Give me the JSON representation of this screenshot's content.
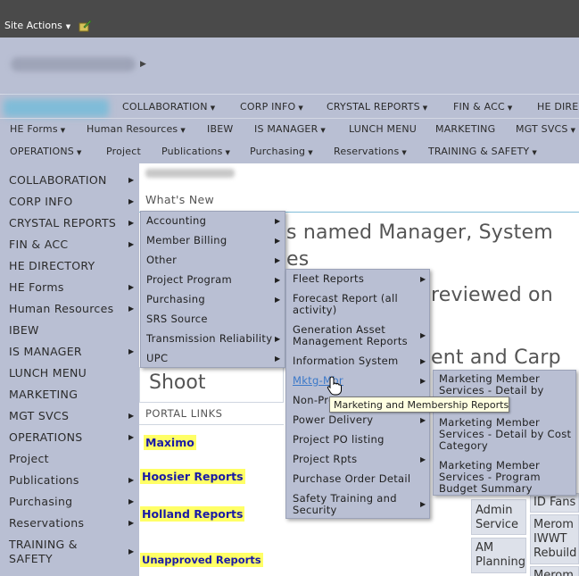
{
  "ribbon": {
    "site_actions_label": "Site Actions",
    "caret": "▼"
  },
  "top_nav": {
    "row1": [
      "COLLABORATION",
      "CORP INFO",
      "CRYSTAL REPORTS",
      "FIN & ACC",
      "HE DIRE"
    ],
    "row2": [
      "HE Forms",
      "Human Resources",
      "IBEW",
      "IS MANAGER",
      "LUNCH MENU",
      "MARKETING",
      "MGT SVCS"
    ],
    "row3": [
      "OPERATIONS",
      "Project",
      "Publications",
      "Purchasing",
      "Reservations",
      "TRAINING & SAFETY"
    ],
    "caret": "▼"
  },
  "sidebar": {
    "items": [
      "COLLABORATION",
      "CORP INFO",
      "CRYSTAL REPORTS",
      "FIN & ACC",
      "HE DIRECTORY",
      "HE Forms",
      "Human Resources",
      "IBEW",
      "IS MANAGER",
      "LUNCH MENU",
      "MARKETING",
      "MGT SVCS",
      "OPERATIONS",
      "Project",
      "Publications",
      "Purchasing",
      "Reservations",
      "TRAINING &",
      "SAFETY"
    ],
    "arrow": "▶"
  },
  "main": {
    "whats_new": "What's New",
    "big_line1": "s named Manager, System",
    "big_line2": "es",
    "big_line3": "reviewed on",
    "big_line4": "ent and Carp",
    "shoot": "Shoot",
    "portal_links": "PORTAL LINKS",
    "links": [
      "Maximo",
      "Hoosier Reports",
      "Holland Reports",
      "Unapproved Reports"
    ]
  },
  "tiles": [
    "Admin\nService",
    "AM\nPlanning",
    "ID Fans",
    "Merom\nIWWT\nRebuild",
    "Merom"
  ],
  "flyout1": {
    "items": [
      "Accounting",
      "Member Billing",
      "Other",
      "Project Program",
      "Purchasing",
      "SRS Source",
      "Transmission Reliability",
      "UPC"
    ]
  },
  "flyout2": {
    "items": [
      "Fleet Reports",
      "Forecast Report (all\nactivity)",
      "Generation Asset\nManagement Reports",
      "Information System",
      "Mktg-Mbr",
      "Non-Pro",
      "Power Delivery",
      "Project PO listing",
      "Project Rpts",
      "Purchase Order Detail",
      "Safety Training and\nSecurity"
    ]
  },
  "flyout3": {
    "items": [
      "Marketing Member\nServices - Detail by",
      "Marketing Member\nServices - Detail by Cost\nCategory",
      "Marketing Member\nServices - Program\nBudget Summary"
    ]
  },
  "tooltip": "Marketing and Membership Reports"
}
